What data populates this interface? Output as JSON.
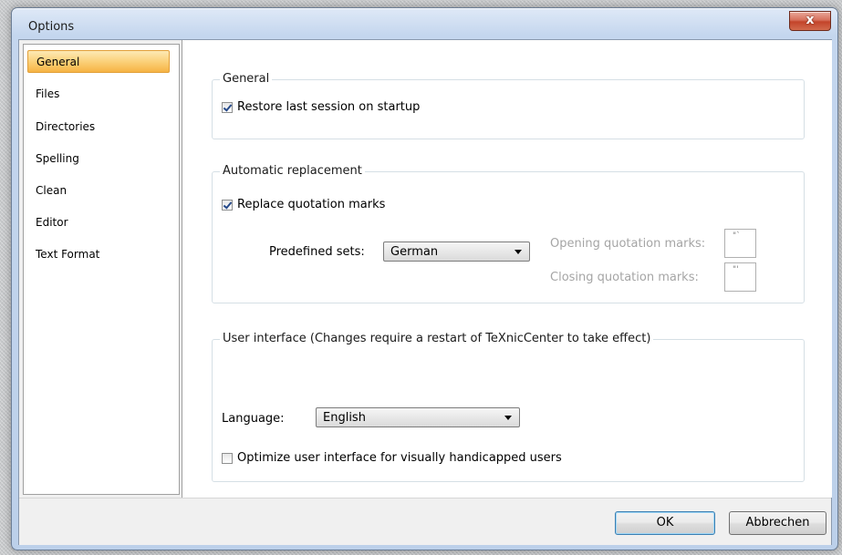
{
  "window": {
    "title": "Options",
    "close_glyph": "x"
  },
  "nav": {
    "items": [
      {
        "label": "General",
        "selected": true
      },
      {
        "label": "Files",
        "selected": false
      },
      {
        "label": "Directories",
        "selected": false
      },
      {
        "label": "Spelling",
        "selected": false
      },
      {
        "label": "Clean",
        "selected": false
      },
      {
        "label": "Editor",
        "selected": false
      },
      {
        "label": "Text Format",
        "selected": false
      }
    ],
    "selected_color": "#f6b344"
  },
  "general_group": {
    "title": "General",
    "restore_session": {
      "label": "Restore last session on startup",
      "checked": true
    }
  },
  "replacement_group": {
    "title": "Automatic replacement",
    "replace_quotes": {
      "label": "Replace quotation marks",
      "checked": true
    },
    "predefined_label": "Predefined sets:",
    "predefined_value": "German",
    "opening_label": "Opening quotation marks:",
    "opening_value": "\"`",
    "closing_label": "Closing quotation marks:",
    "closing_value": "\"'"
  },
  "ui_group": {
    "title": "User interface (Changes require a restart of TeXnicCenter to take effect)",
    "language_label": "Language:",
    "language_value": "English",
    "optimize": {
      "label": "Optimize user interface for visually handicapped users",
      "checked": false
    }
  },
  "buttons": {
    "ok": "OK",
    "cancel": "Abbrechen"
  }
}
